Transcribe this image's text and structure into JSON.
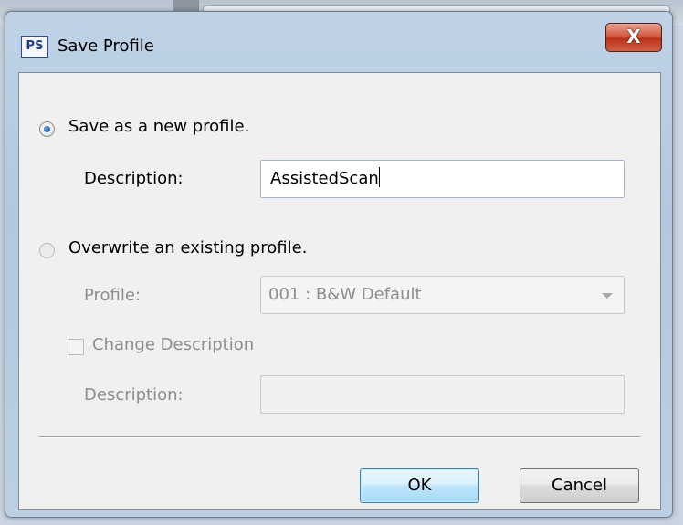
{
  "window": {
    "icon_text": "PS",
    "title": "Save Profile",
    "close_glyph": "X"
  },
  "option_new": {
    "label": "Save as a new profile.",
    "selected": true,
    "description_label": "Description:",
    "description_value": "AssistedScan"
  },
  "option_overwrite": {
    "label": "Overwrite an existing profile.",
    "selected": false,
    "profile_label": "Profile:",
    "profile_value": "001 : B&W Default",
    "change_description_label": "Change Description",
    "change_description_checked": false,
    "description_label": "Description:",
    "description_value": ""
  },
  "buttons": {
    "ok": "OK",
    "cancel": "Cancel"
  },
  "colors": {
    "accent": "#1a5bb8",
    "close_button": "#c7432a",
    "disabled_text": "#8d8d8d"
  }
}
